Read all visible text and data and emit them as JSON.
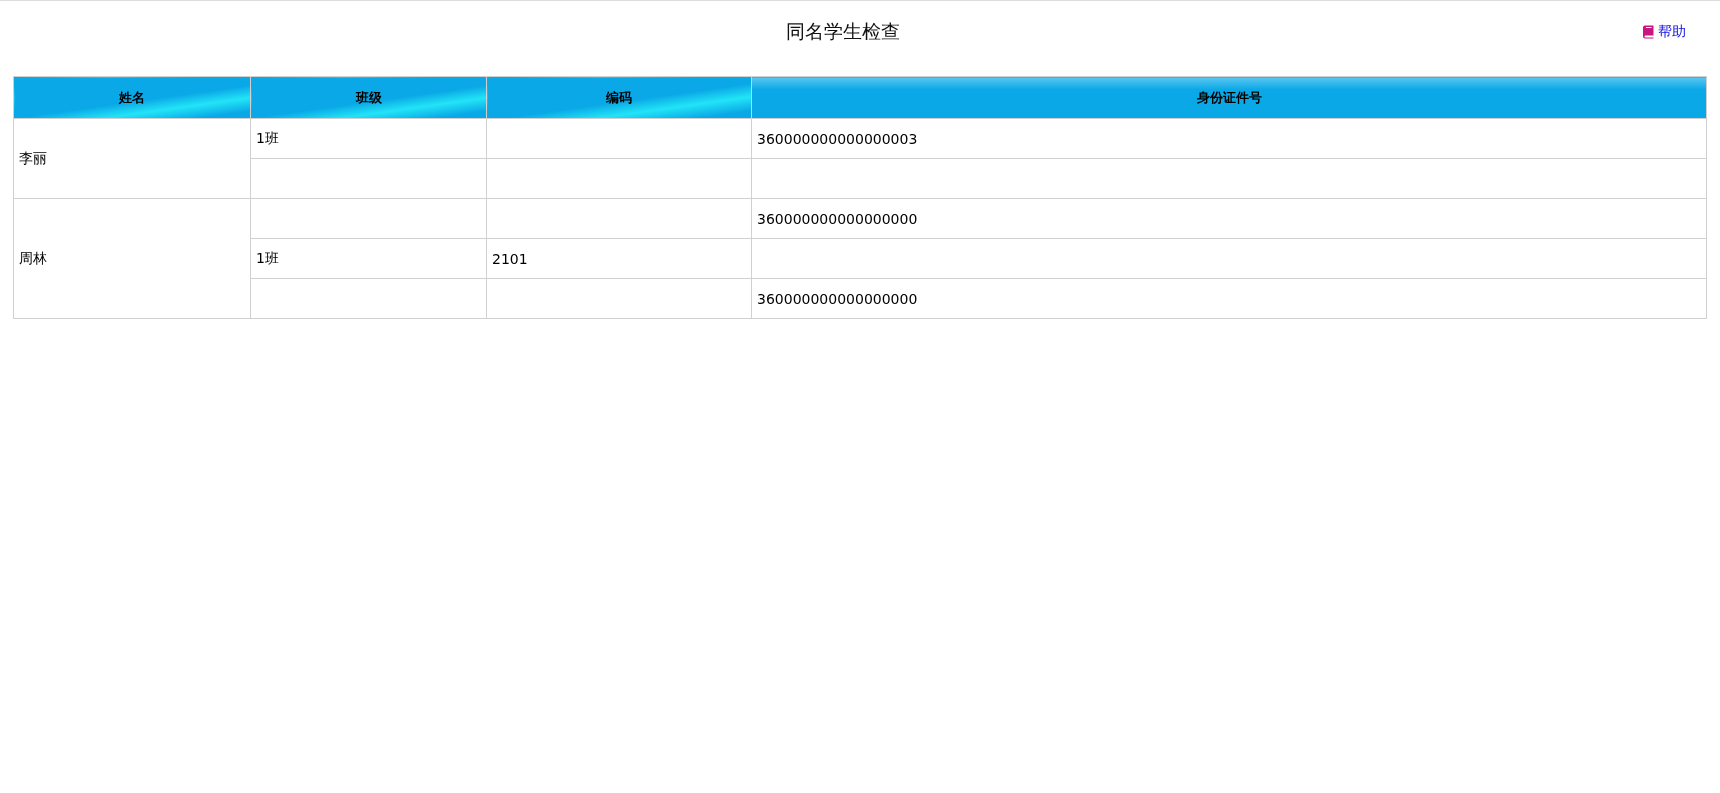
{
  "page": {
    "title": "同名学生检查",
    "help_link": "帮助"
  },
  "table": {
    "columns": [
      "姓名",
      "班级",
      "编码",
      "身份证件号"
    ],
    "groups": [
      {
        "name": "李丽",
        "rows": [
          {
            "class": "1班",
            "id_number": "360000000000000003"
          },
          {}
        ]
      },
      {
        "name": "周林",
        "rows": [
          {
            "id_number": "360000000000000000"
          },
          {
            "class": "1班",
            "code": "2101"
          },
          {
            "id_number": "360000000000000000"
          }
        ]
      }
    ]
  }
}
